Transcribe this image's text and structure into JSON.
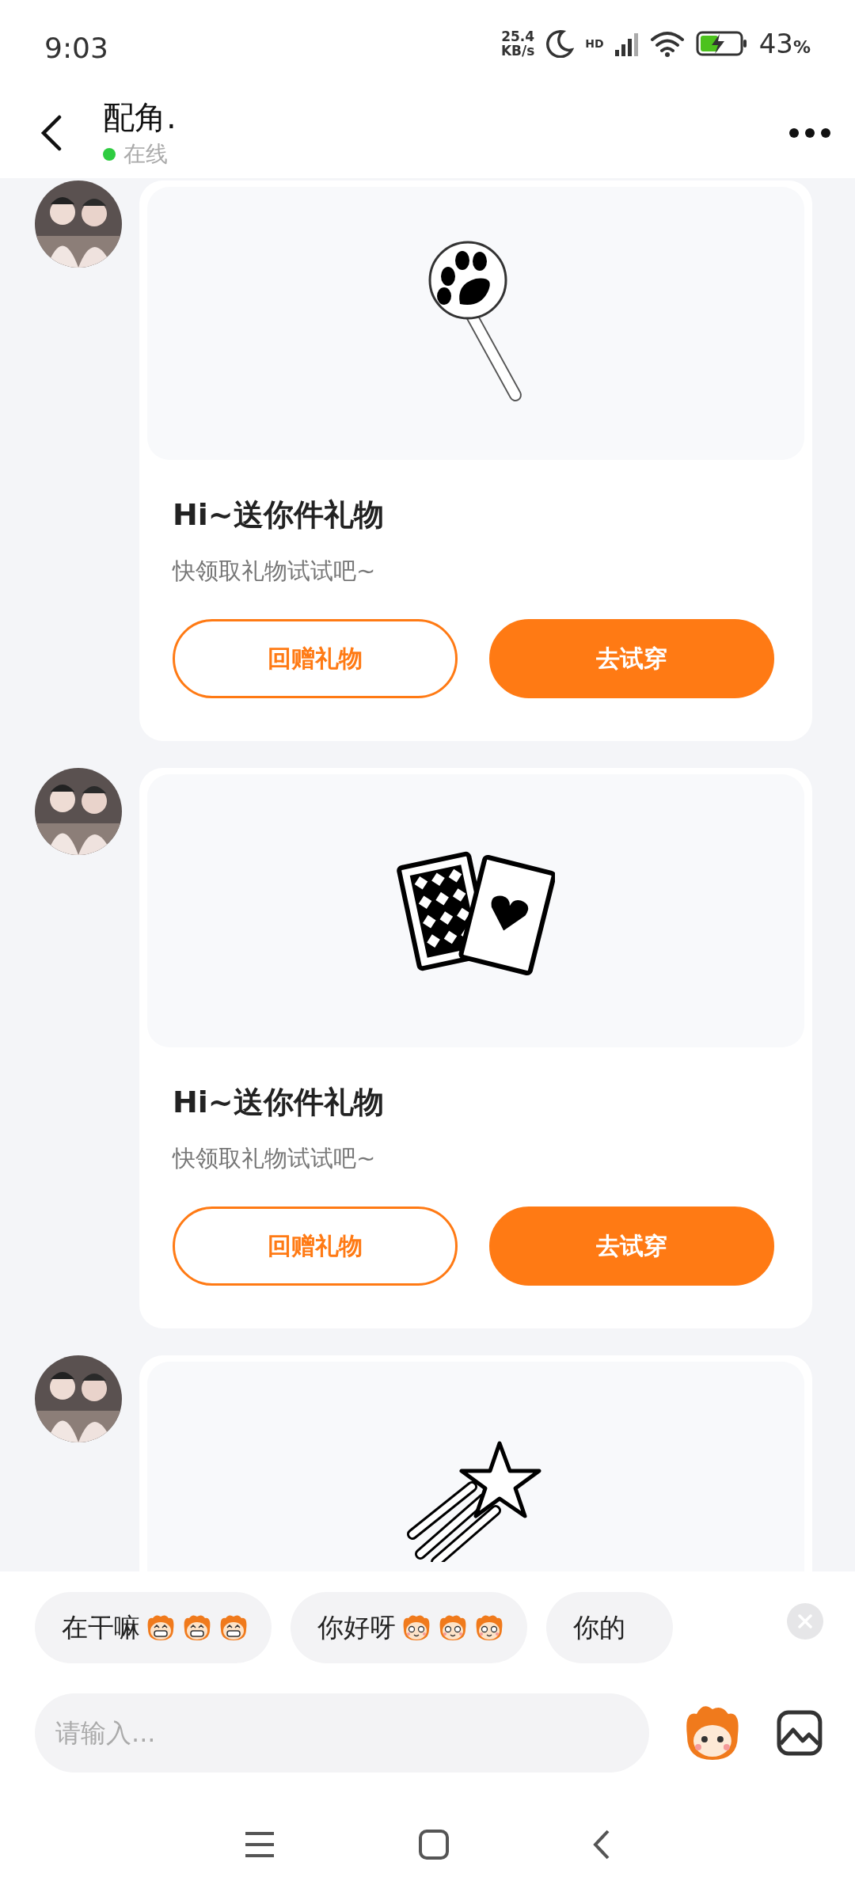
{
  "status_bar": {
    "time": "9:03",
    "net_speed": "25.4",
    "net_unit": "KB/s",
    "network": "HD",
    "battery": "43",
    "battery_unit": "%"
  },
  "header": {
    "title": "配角.",
    "status": "在线",
    "online": true
  },
  "messages": [
    {
      "kind": "paw-wand",
      "title": "Hi~送你件礼物",
      "subtitle": "快领取礼物试试吧~",
      "buttons": [
        {
          "label": "回赠礼物",
          "kind": "outline"
        },
        {
          "label": "去试穿",
          "kind": "filled"
        }
      ]
    },
    {
      "kind": "cards",
      "title": "Hi~送你件礼物",
      "subtitle": "快领取礼物试试吧~",
      "buttons": [
        {
          "label": "回赠礼物",
          "kind": "outline"
        },
        {
          "label": "去试穿",
          "kind": "filled"
        }
      ]
    },
    {
      "kind": "shooting-star"
    }
  ],
  "quick_replies": [
    {
      "text": "在干嘛",
      "emojis": [
        {
          "kind": "grin"
        },
        {
          "kind": "grin"
        },
        {
          "kind": "grin"
        }
      ]
    },
    {
      "text": "你好呀",
      "emojis": [
        {
          "kind": "smile"
        },
        {
          "kind": "smile"
        },
        {
          "kind": "smile"
        }
      ]
    },
    {
      "text": "你的"
    }
  ],
  "input": {
    "placeholder": "请输入..."
  }
}
